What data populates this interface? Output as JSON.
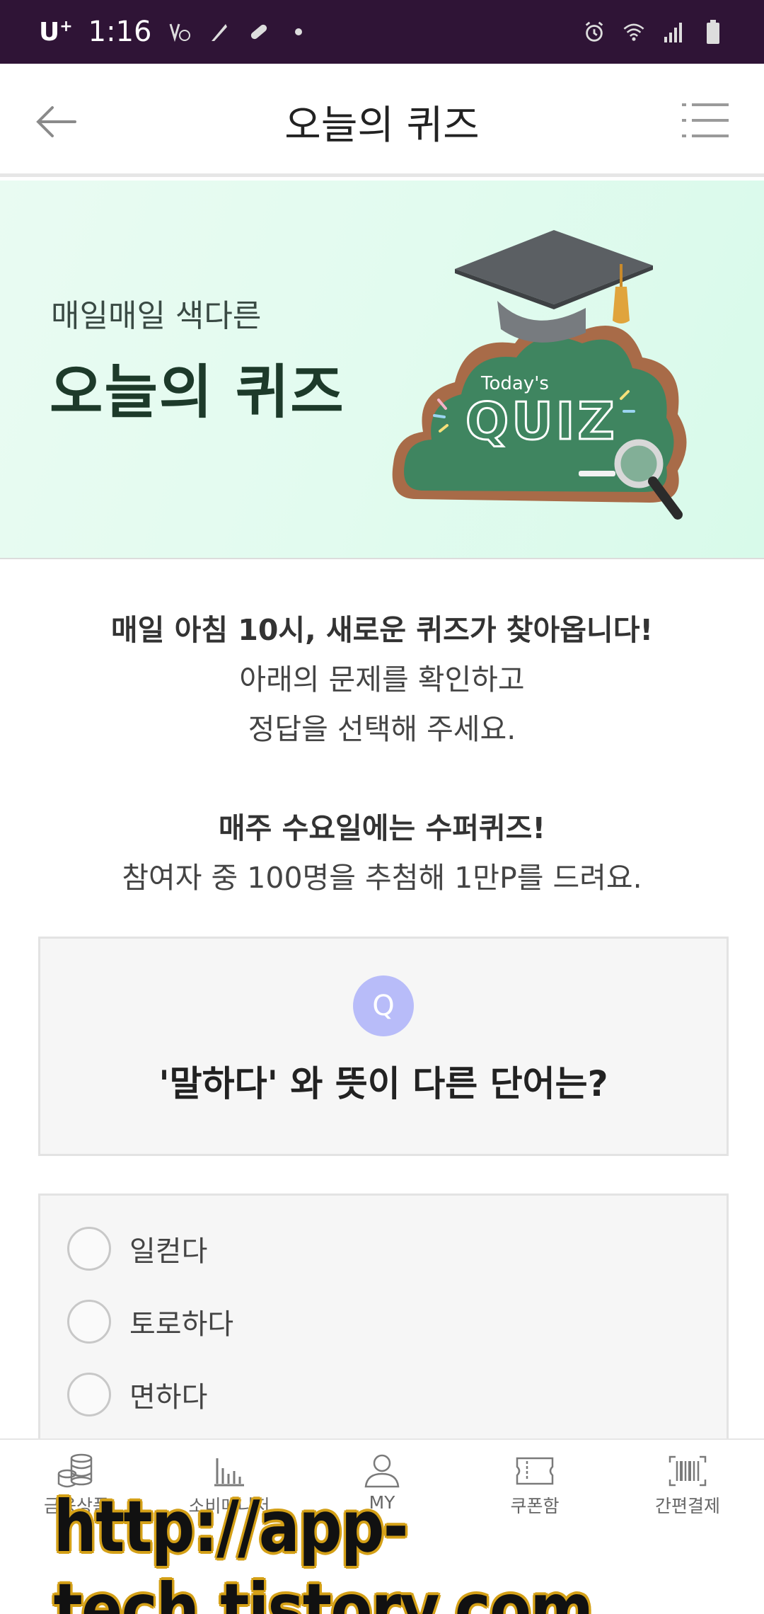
{
  "status_bar": {
    "carrier": "U",
    "carrier_sup": "+",
    "time": "1:16",
    "bg_color": "#2f1436"
  },
  "header": {
    "title": "오늘의 퀴즈",
    "back_icon": "arrow-left-icon",
    "menu_icon": "menu-icon"
  },
  "banner": {
    "subtitle": "매일매일 색다른",
    "title": "오늘의 퀴즈",
    "art_small_text": "Today's",
    "art_big_text": "QUIZ"
  },
  "intro": {
    "line1": "매일 아침 10시, 새로운 퀴즈가 찾아옵니다!",
    "line2": "아래의 문제를 확인하고",
    "line3": "정답을 선택해 주세요.",
    "line4": "매주 수요일에는 수퍼퀴즈!",
    "line5": "참여자 중 100명을 추첨해 1만P를 드려요."
  },
  "question": {
    "badge": "Q",
    "text": "'말하다' 와 뜻이 다른 단어는?",
    "badge_color": "#b8bcf9"
  },
  "options": [
    {
      "label": "일컫다"
    },
    {
      "label": "토로하다"
    },
    {
      "label": "면하다"
    }
  ],
  "bottom_nav": [
    {
      "label": "금융상품",
      "icon": "coins-icon"
    },
    {
      "label": "소비매니저",
      "icon": "bar-chart-icon"
    },
    {
      "label": "MY",
      "icon": "user-icon"
    },
    {
      "label": "쿠폰함",
      "icon": "ticket-icon"
    },
    {
      "label": "간편결제",
      "icon": "barcode-icon"
    }
  ],
  "watermark": {
    "text": "http://app-tech.tistory.com"
  }
}
